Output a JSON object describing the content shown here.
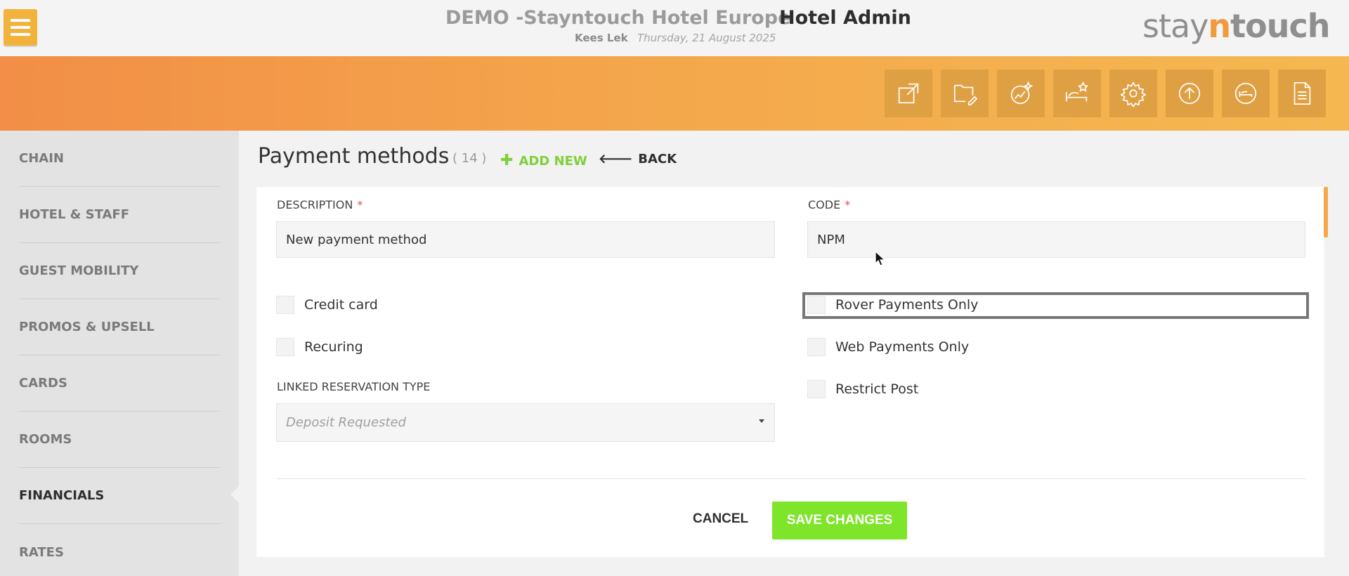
{
  "header": {
    "hotel_name": "DEMO -Stayntouch Hotel Europe",
    "section": "Hotel Admin",
    "user": "Kees Lek",
    "date": "Thursday, 21 August 2025",
    "logo": {
      "part1": "stay",
      "part2": "n",
      "part3": "touch"
    }
  },
  "toolbar": {
    "icons": [
      "external-link-icon",
      "folder-edit-icon",
      "sparkle-chart-icon",
      "bed-star-icon",
      "gear-icon",
      "upload-circle-icon",
      "bed-circle-icon",
      "document-icon"
    ]
  },
  "sidebar": {
    "items": [
      {
        "label": "CHAIN",
        "active": false
      },
      {
        "label": "HOTEL & STAFF",
        "active": false
      },
      {
        "label": "GUEST MOBILITY",
        "active": false
      },
      {
        "label": "PROMOS & UPSELL",
        "active": false
      },
      {
        "label": "CARDS",
        "active": false
      },
      {
        "label": "ROOMS",
        "active": false
      },
      {
        "label": "FINANCIALS",
        "active": true
      },
      {
        "label": "RATES",
        "active": false
      }
    ]
  },
  "main": {
    "title": "Payment methods",
    "count": "( 14 )",
    "add_new": "ADD NEW",
    "back": "BACK"
  },
  "form": {
    "description_label": "DESCRIPTION",
    "description_value": "New payment method",
    "code_label": "CODE",
    "code_value": "NPM",
    "required_mark": "*",
    "checkboxes_left": [
      "Credit card",
      "Recuring"
    ],
    "checkboxes_right": [
      "Rover Payments Only",
      "Web Payments Only",
      "Restrict Post"
    ],
    "linked_label": "LINKED RESERVATION TYPE",
    "linked_placeholder": "Deposit Requested",
    "cancel_label": "CANCEL",
    "save_label": "SAVE CHANGES"
  },
  "colors": {
    "accent_orange": "#f29a3e",
    "save_green": "#7fe52a",
    "add_green": "#7ed03a",
    "required_red": "#d9534f"
  }
}
